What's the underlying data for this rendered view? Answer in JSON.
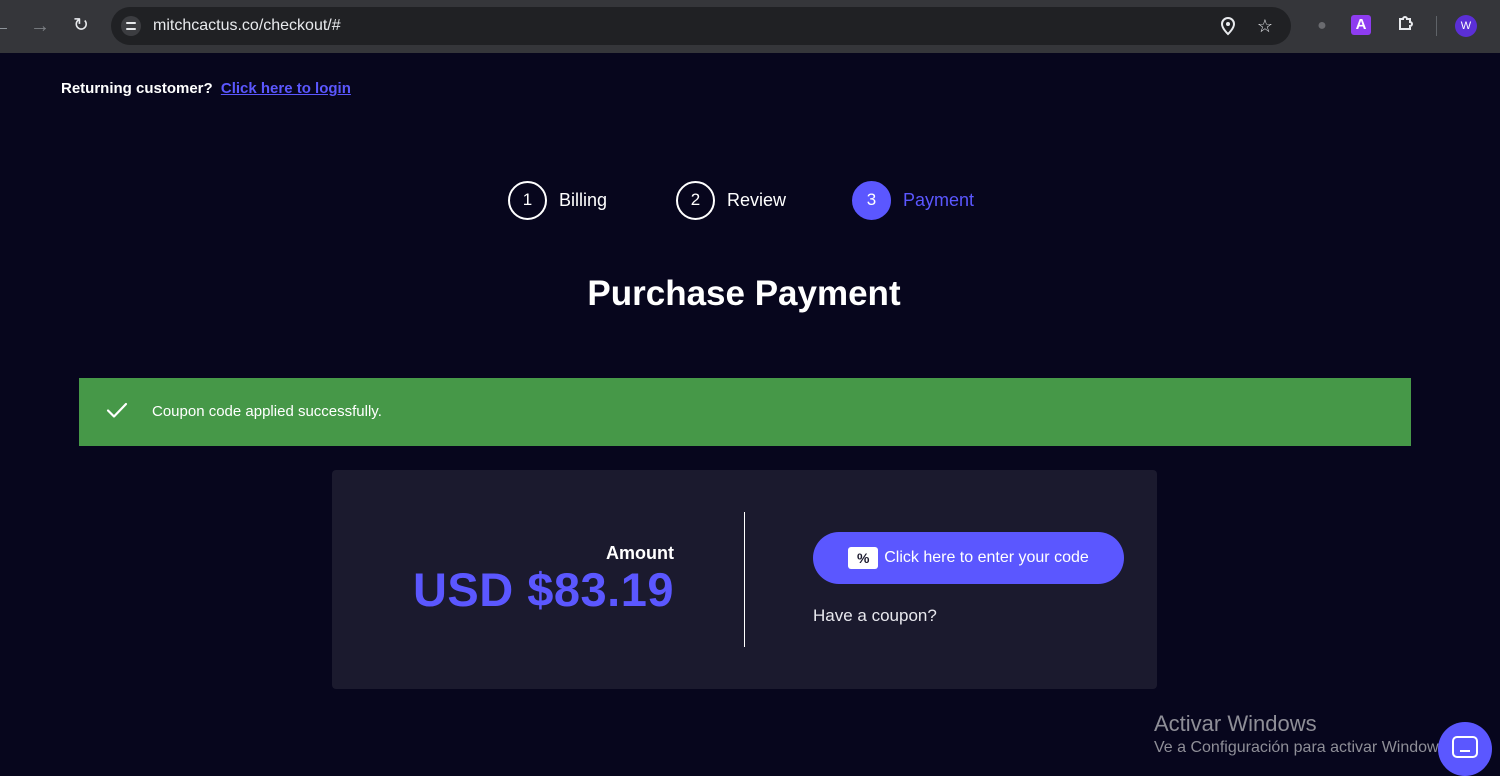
{
  "browser": {
    "url": "mitchcactus.co/checkout/#",
    "profile_initial": "W",
    "extension_letter": "A",
    "icons": [
      "back-icon",
      "forward-icon",
      "reload-icon",
      "site-info-icon",
      "location-icon",
      "star-icon",
      "robot-extension-icon",
      "a-extension-icon",
      "puzzle-icon"
    ]
  },
  "login_prompt": {
    "text": "Returning customer?",
    "link": "Click here to login"
  },
  "steps": [
    {
      "number": "1",
      "label": "Billing"
    },
    {
      "number": "2",
      "label": "Review"
    },
    {
      "number": "3",
      "label": "Payment",
      "active": true
    }
  ],
  "title": "Purchase Payment",
  "notice": {
    "message": "Coupon code applied successfully.",
    "color": "#469848"
  },
  "payment": {
    "amount_label": "Amount",
    "amount_value": "USD $83.19",
    "coupon_button": "Click here to enter your code",
    "coupon_icon": "%",
    "coupon_prompt": "Have a coupon?"
  },
  "watermark": {
    "title": "Activar Windows",
    "subtitle": "Ve a Configuración para activar Windows."
  },
  "colors": {
    "accent": "#5b57ff",
    "background": "#07061d",
    "card": "#1b1a2e"
  }
}
